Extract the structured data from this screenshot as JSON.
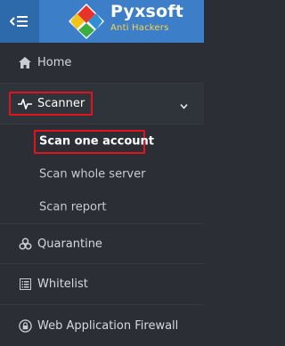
{
  "header": {
    "brand_name": "Pyxsoft",
    "brand_subtitle": "Anti Hackers",
    "colors": {
      "bar": "#3c7ec8",
      "toggle": "#2d6aab",
      "subtitle": "#ffd24a"
    }
  },
  "sidebar": {
    "items": [
      {
        "label": "Home",
        "icon": "home-icon"
      },
      {
        "label": "Scanner",
        "icon": "pulse-icon",
        "expanded": true,
        "children": [
          {
            "label": "Scan one account",
            "current": true
          },
          {
            "label": "Scan whole server"
          },
          {
            "label": "Scan report"
          }
        ]
      },
      {
        "label": "Quarantine",
        "icon": "biohazard-icon"
      },
      {
        "label": "Whitelist",
        "icon": "list-icon"
      },
      {
        "label": "Web Application Firewall",
        "icon": "lock-icon"
      }
    ],
    "highlight_color": "#e0141e"
  }
}
